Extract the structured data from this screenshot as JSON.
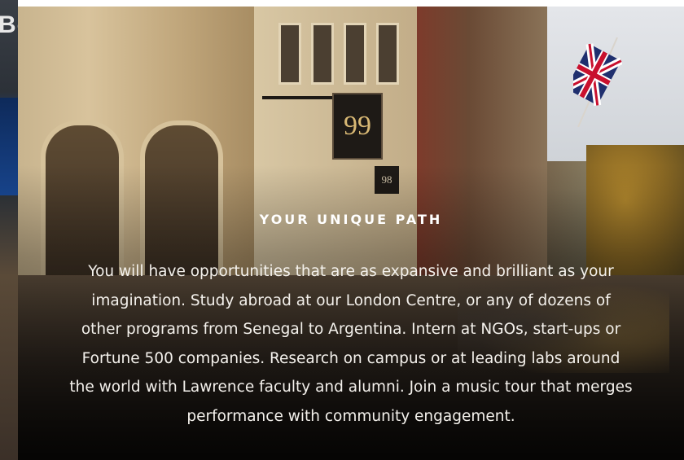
{
  "previous_slide": {
    "visible_text": "Bo"
  },
  "slide": {
    "image": {
      "sign_large_number": "99",
      "sign_small_number": "98"
    },
    "heading": "YOUR UNIQUE PATH",
    "body_lines": [
      "You will have opportunities that are as expansive and brilliant as your",
      "imagination. Study abroad at our London Centre, or any of dozens of",
      "other programs from Senegal to Argentina. Intern at NGOs, start-ups or",
      "Fortune 500 companies. Research on campus or at leading labs around",
      "the world with Lawrence faculty and alumni. Join a music tour that merges",
      "performance with community engagement."
    ]
  },
  "colors": {
    "heading_text": "#ffffff",
    "body_text": "#f4f1ec",
    "overlay": "#000000"
  }
}
